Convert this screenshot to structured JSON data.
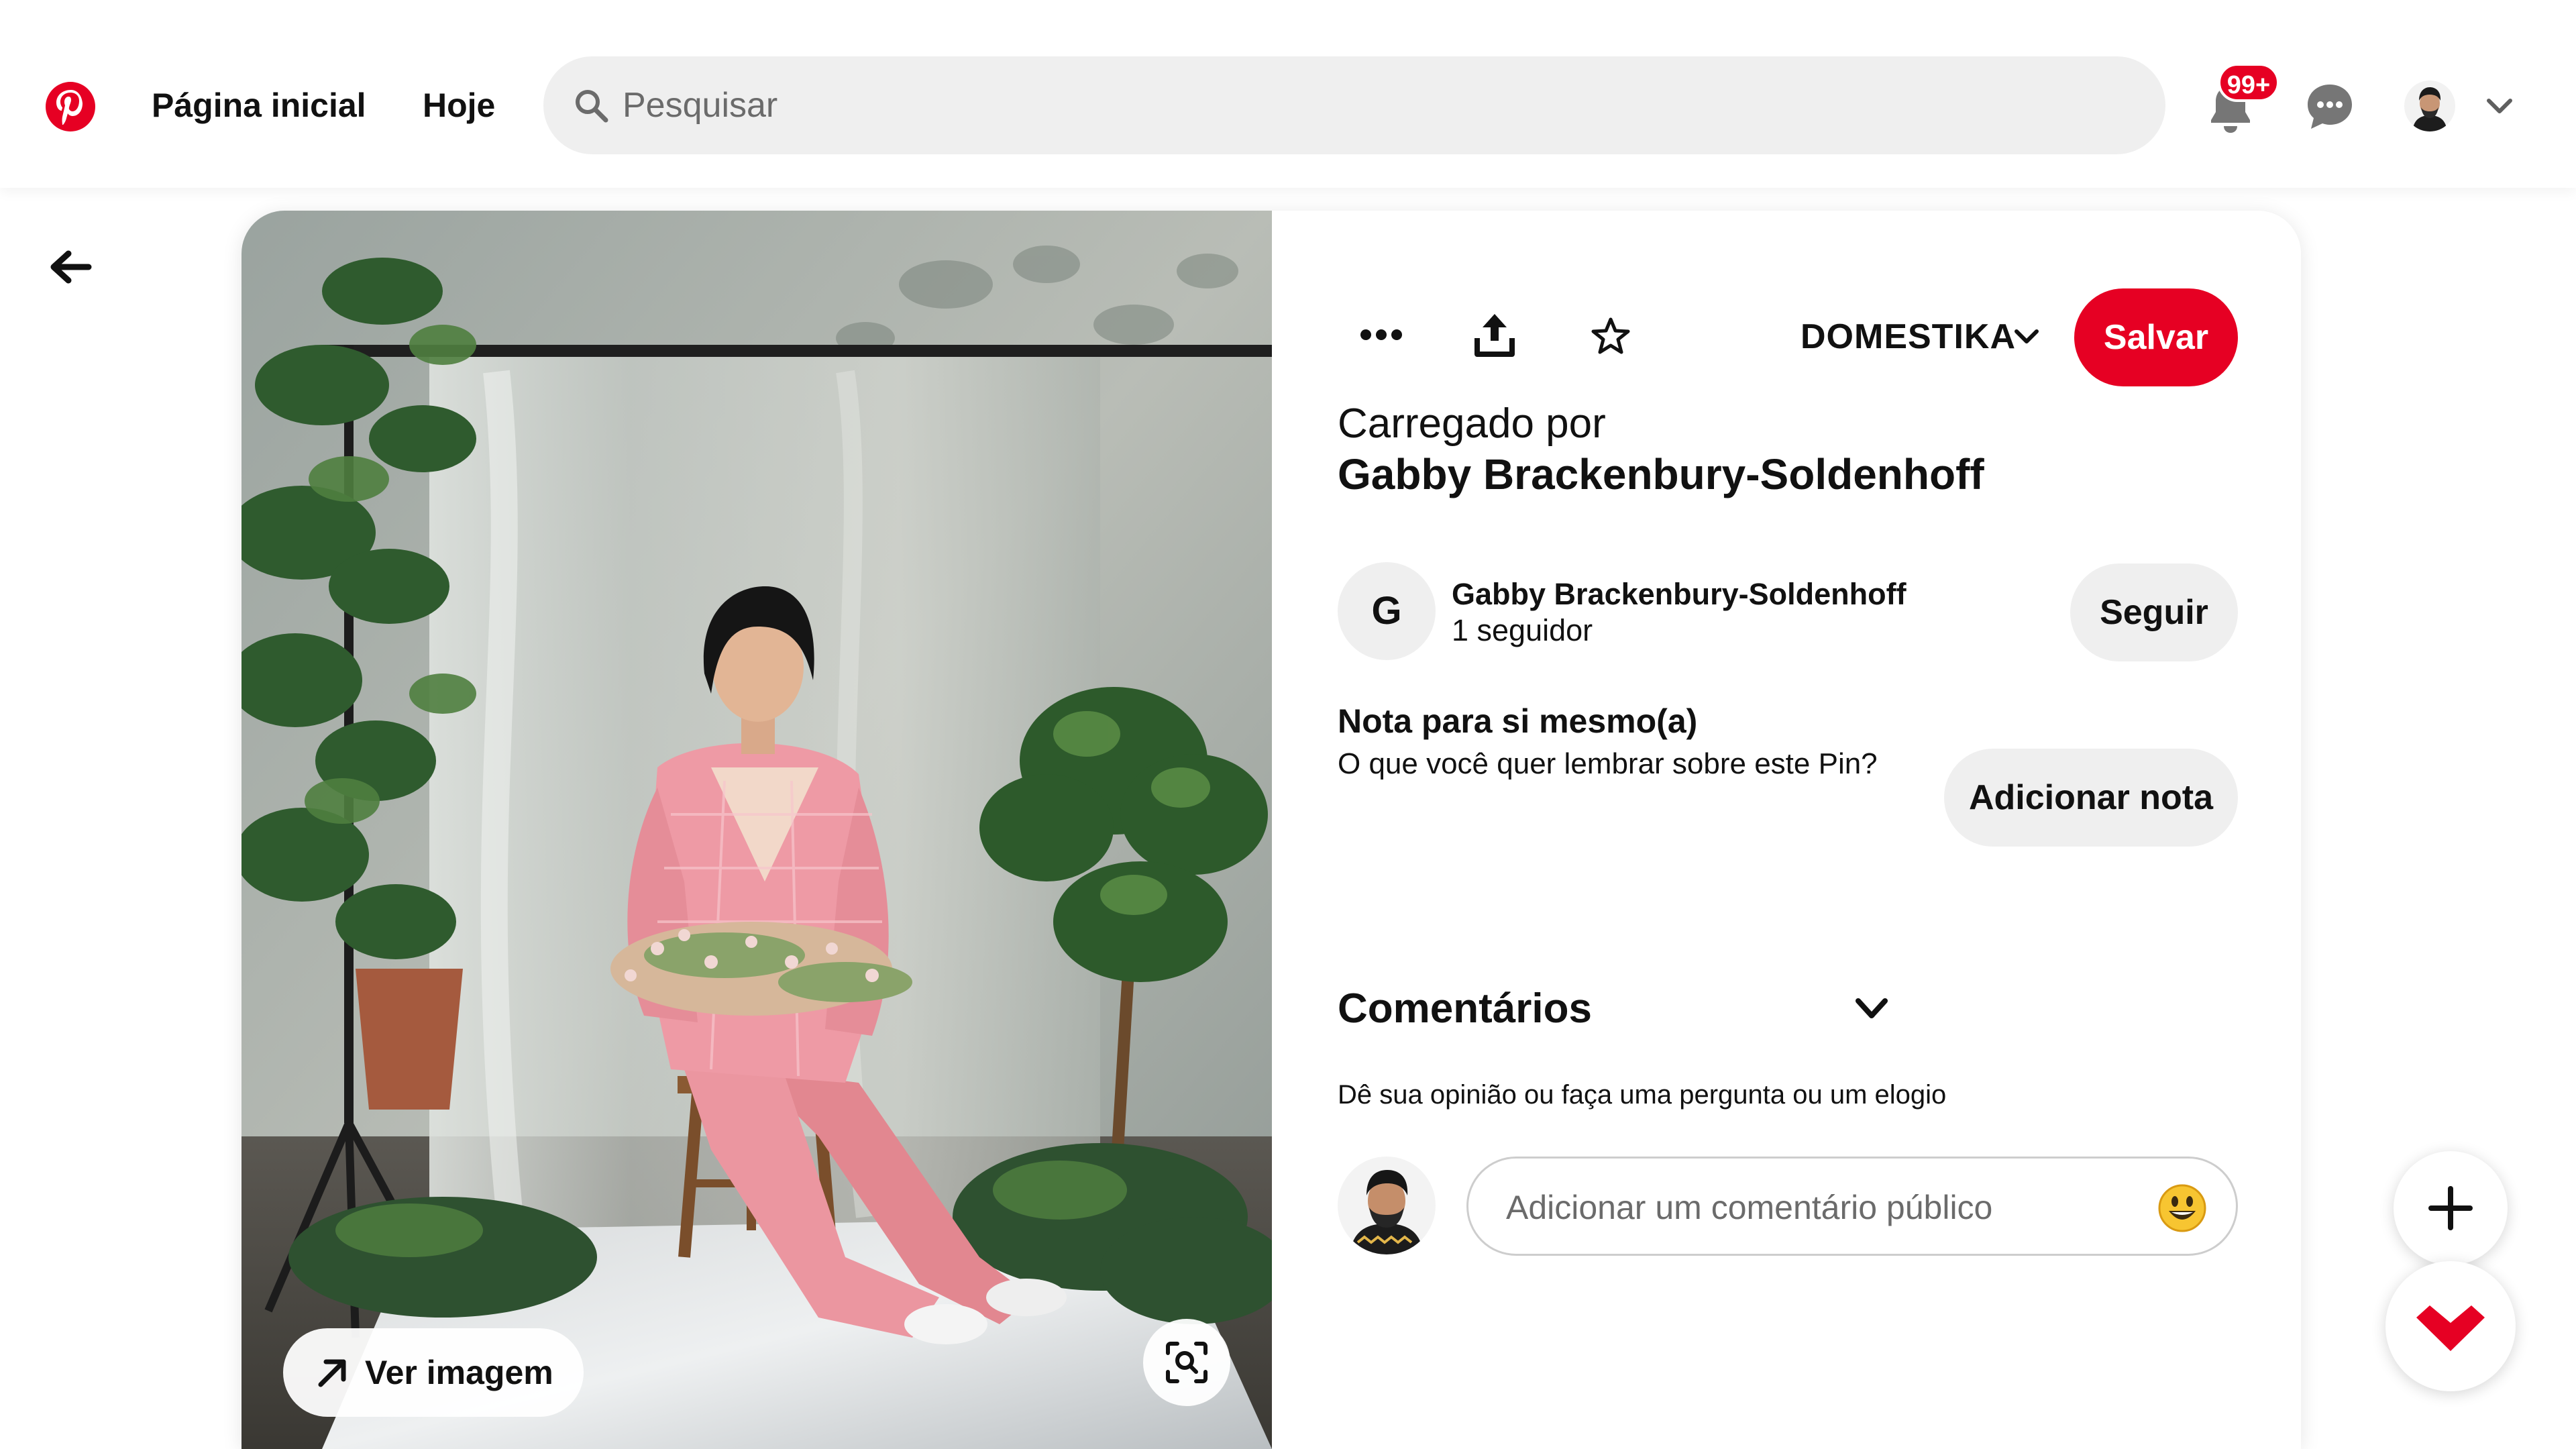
{
  "header": {
    "logo_icon": "pinterest-logo-icon",
    "nav_home": "Página inicial",
    "nav_today": "Hoje",
    "search_placeholder": "Pesquisar",
    "notifications_badge": "99+",
    "icons": [
      "search-icon",
      "bell-icon",
      "chat-icon",
      "chevron-down-icon"
    ]
  },
  "pin": {
    "view_image_label": "Ver imagem",
    "board_name": "DOMESTIKA",
    "save_label": "Salvar",
    "uploaded_by_label": "Carregado por",
    "uploaded_by_name": "Gabby Brackenbury-Soldenhoff",
    "creator": {
      "initial": "G",
      "name": "Gabby Brackenbury-Soldenhoff",
      "followers": "1 seguidor",
      "follow_label": "Seguir"
    },
    "note": {
      "title": "Nota para si mesmo(a)",
      "description": "O que você quer lembrar sobre este Pin?",
      "button_label": "Adicionar nota"
    },
    "comments": {
      "title": "Comentários",
      "hint": "Dê sua opinião ou faça uma pergunta ou um elogio",
      "input_placeholder": "Adicionar um comentário público"
    }
  },
  "colors": {
    "brand_red": "#e60023",
    "pill_gray": "#efefef",
    "text": "#111111"
  }
}
